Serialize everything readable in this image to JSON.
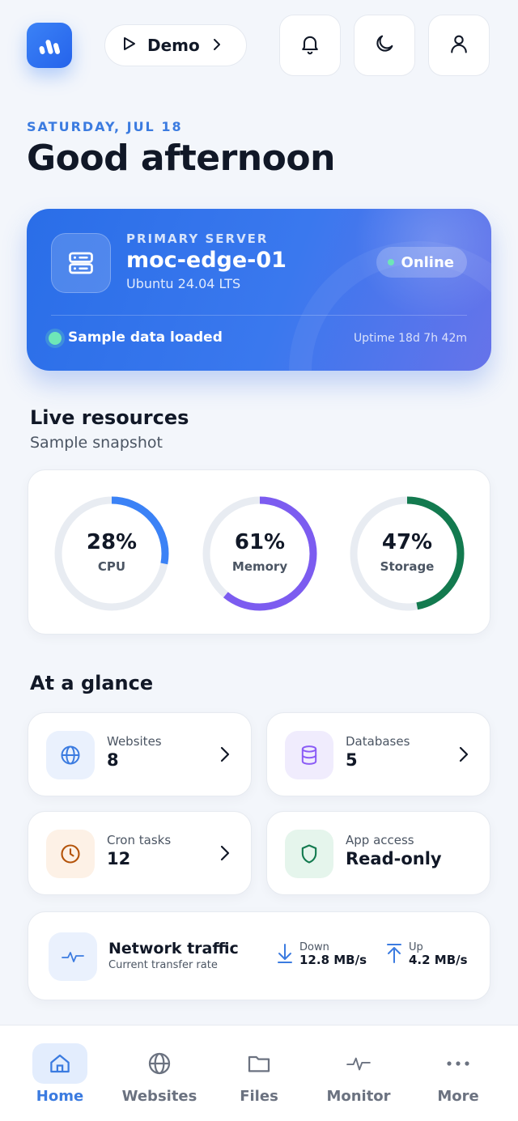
{
  "header": {
    "demo_label": "Demo",
    "logo_icon": "bars-logo-icon",
    "icons": [
      "bell-icon",
      "moon-icon",
      "user-icon"
    ]
  },
  "date": "SATURDAY, JUL 18",
  "greeting": "Good afternoon",
  "server": {
    "kicker": "PRIMARY SERVER",
    "name": "moc-edge-01",
    "os": "Ubuntu 24.04 LTS",
    "status": "Online",
    "sample_note": "Sample data loaded",
    "uptime": "Uptime 18d 7h 42m",
    "icon": "server-icon"
  },
  "resources": {
    "title": "Live resources",
    "subtitle": "Sample snapshot",
    "gauges": [
      {
        "value": "28%",
        "label": "CPU",
        "percent": 28,
        "color": "#3b82f6"
      },
      {
        "value": "61%",
        "label": "Memory",
        "percent": 61,
        "color": "#7c5cf0"
      },
      {
        "value": "47%",
        "label": "Storage",
        "percent": 47,
        "color": "#137a4f"
      }
    ]
  },
  "glance": {
    "title": "At a glance",
    "tiles": [
      {
        "label": "Websites",
        "value": "8",
        "icon": "globe-icon",
        "icon_color": "#3b7be0",
        "bg": "#eaf1fd"
      },
      {
        "label": "Databases",
        "value": "5",
        "icon": "database-icon",
        "icon_color": "#8b5cf6",
        "bg": "#f0ecfd"
      },
      {
        "label": "Cron tasks",
        "value": "12",
        "icon": "clock-icon",
        "icon_color": "#b45309",
        "bg": "#fdf1e6"
      },
      {
        "label": "App access",
        "value": "Read-only",
        "icon": "shield-icon",
        "icon_color": "#137a4f",
        "bg": "#e5f5ec"
      }
    ]
  },
  "network": {
    "title": "Network traffic",
    "subtitle": "Current transfer rate",
    "down_label": "Down",
    "down_value": "12.8 MB/s",
    "up_label": "Up",
    "up_value": "4.2 MB/s",
    "icon": "activity-icon"
  },
  "nav": {
    "items": [
      {
        "label": "Home",
        "icon": "home-icon",
        "active": true
      },
      {
        "label": "Websites",
        "icon": "globe-icon",
        "active": false
      },
      {
        "label": "Files",
        "icon": "folder-icon",
        "active": false
      },
      {
        "label": "Monitor",
        "icon": "activity-icon",
        "active": false
      },
      {
        "label": "More",
        "icon": "more-dots-icon",
        "active": false
      }
    ]
  },
  "colors": {
    "accent": "#3b7be0",
    "background": "#f3f6fb"
  }
}
